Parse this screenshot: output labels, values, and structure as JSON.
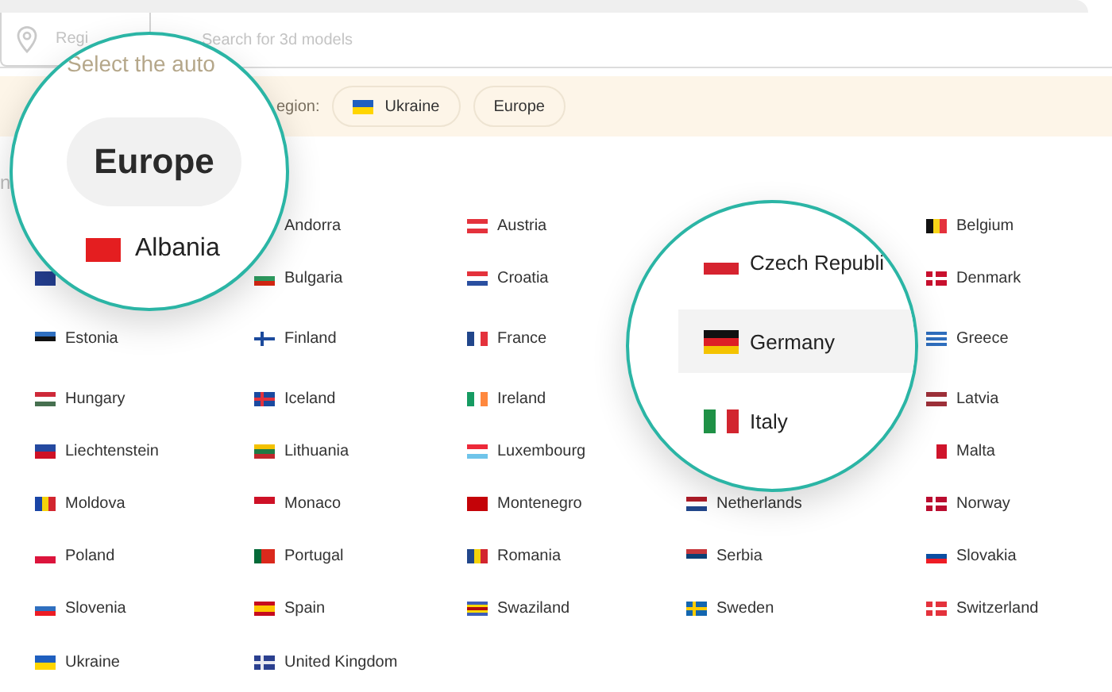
{
  "search_bar": {
    "region_placeholder": "Regi",
    "placeholder": "Search for 3d models"
  },
  "banner": {
    "label": "egion:",
    "chips": [
      {
        "label": "Ukraine",
        "kind": "ukraine"
      },
      {
        "label": "Europe",
        "kind": "plain"
      }
    ]
  },
  "edge_text": "n",
  "countries": [
    [
      {
        "kind": "covered"
      },
      {
        "kind": "plain",
        "name": "Andorra"
      },
      {
        "kind": "austria",
        "name": "Austria"
      },
      {
        "kind": "covered"
      },
      {
        "kind": "belgium",
        "name": "Belgium"
      }
    ],
    [
      {
        "kind": "bosnia"
      },
      {
        "kind": "bulgaria",
        "name": "Bulgaria"
      },
      {
        "kind": "croatia",
        "name": "Croatia"
      },
      {
        "kind": "covered"
      },
      {
        "kind": "denmark",
        "name": "Denmark"
      }
    ],
    [
      {
        "kind": "estonia",
        "name": "Estonia"
      },
      {
        "kind": "finland",
        "name": "Finland"
      },
      {
        "kind": "france",
        "name": "France"
      },
      {
        "kind": "covered"
      },
      {
        "kind": "greece",
        "name": "Greece"
      }
    ],
    [
      {
        "kind": "hungary",
        "name": "Hungary"
      },
      {
        "kind": "iceland",
        "name": "Iceland"
      },
      {
        "kind": "ireland",
        "name": "Ireland"
      },
      {
        "kind": "covered"
      },
      {
        "kind": "latvia",
        "name": "Latvia"
      }
    ],
    [
      {
        "kind": "liechtenstein",
        "name": "Liechtenstein"
      },
      {
        "kind": "lithuania",
        "name": "Lithuania"
      },
      {
        "kind": "luxembourg",
        "name": "Luxembourg"
      },
      {
        "kind": "covered"
      },
      {
        "kind": "malta",
        "name": "Malta"
      }
    ],
    [
      {
        "kind": "moldova",
        "name": "Moldova"
      },
      {
        "kind": "monaco",
        "name": "Monaco"
      },
      {
        "kind": "montenegro",
        "name": "Montenegro"
      },
      {
        "kind": "netherlands",
        "name": "Netherlands"
      },
      {
        "kind": "norway",
        "name": "Norway"
      }
    ],
    [
      {
        "kind": "poland",
        "name": "Poland"
      },
      {
        "kind": "portugal",
        "name": "Portugal"
      },
      {
        "kind": "romania",
        "name": "Romania"
      },
      {
        "kind": "serbia",
        "name": "Serbia"
      },
      {
        "kind": "slovakia",
        "name": "Slovakia"
      }
    ],
    [
      {
        "kind": "slovenia",
        "name": "Slovenia"
      },
      {
        "kind": "spain",
        "name": "Spain"
      },
      {
        "kind": "swaziland",
        "name": "Swaziland"
      },
      {
        "kind": "sweden",
        "name": "Sweden"
      },
      {
        "kind": "switzerland",
        "name": "Switzerland"
      }
    ],
    [
      {
        "kind": "ukraine",
        "name": "Ukraine"
      },
      {
        "kind": "uk",
        "name": "United Kingdom"
      }
    ]
  ],
  "magnifier_left": {
    "title": "Select the auto",
    "region_pill": "Europe",
    "items": [
      {
        "kind": "albania",
        "name": "Albania"
      }
    ]
  },
  "magnifier_right": {
    "items": [
      {
        "kind": "czech",
        "name": "Czech Republi",
        "selected": false
      },
      {
        "kind": "germany",
        "name": "Germany",
        "selected": true
      },
      {
        "kind": "italy",
        "name": "Italy",
        "selected": false
      }
    ]
  }
}
